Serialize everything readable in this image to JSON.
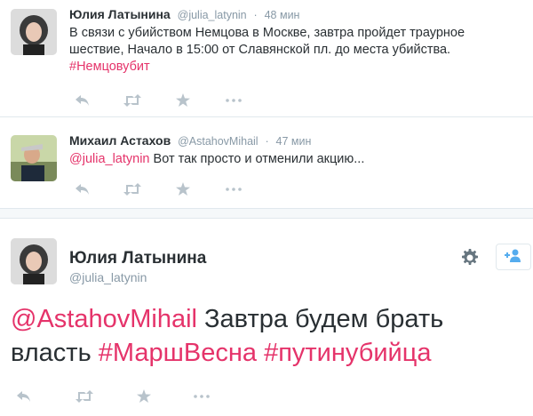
{
  "tweet1": {
    "name": "Юлия Латынина",
    "handle": "@julia_latynin",
    "time": "48 мин",
    "text": "В связи с убийством Немцова в Москве, завтра пройдет траурное шествие, Начало в 15:00 от Славянской пл. до места убийства.",
    "hashtag": "#Немцовубит"
  },
  "tweet2": {
    "name": "Михаил Астахов",
    "handle": "@AstahovMihail",
    "time": "47 мин",
    "mention": "@julia_latynin",
    "text": "Вот так просто и отменили акцию..."
  },
  "tweet3": {
    "name": "Юлия Латынина",
    "handle": "@julia_latynin",
    "mention": "@AstahovMihail",
    "text1": "Завтра будем брать",
    "text2": "власть",
    "hashtag1": "#МаршВесна",
    "hashtag2": "#путинубийца"
  },
  "icons": {
    "reply": "reply-icon",
    "retweet": "retweet-icon",
    "favorite": "star-icon",
    "more": "more-icon",
    "gear": "gear-icon",
    "follow": "follow-icon"
  },
  "colors": {
    "accent": "#e5336a",
    "muted": "#8899a6",
    "action": "#a4b1bb"
  }
}
